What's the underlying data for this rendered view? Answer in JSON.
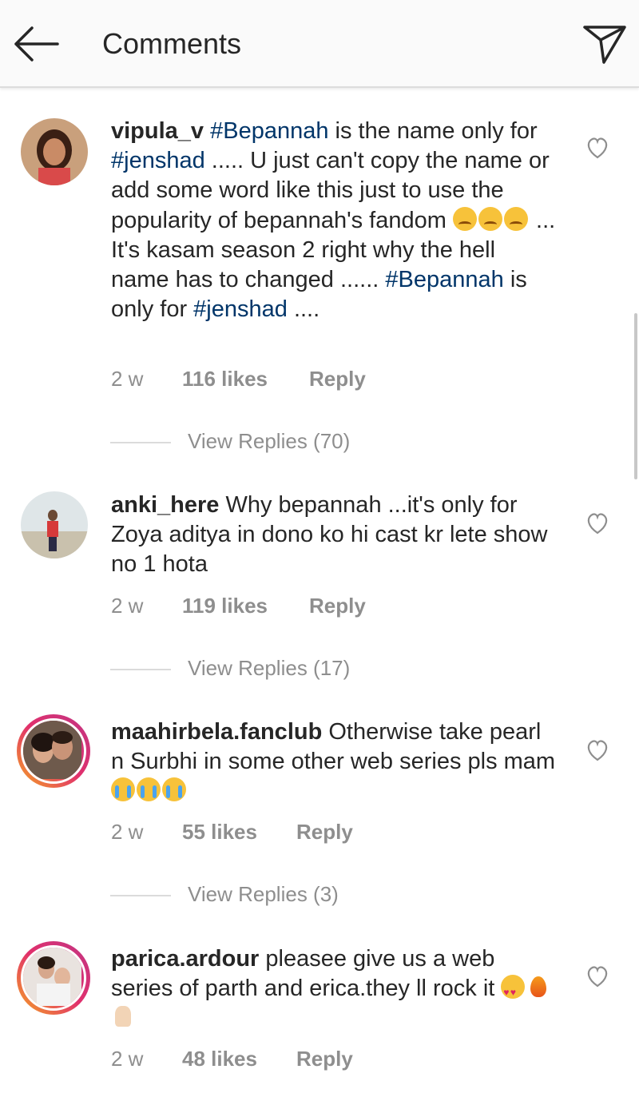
{
  "header": {
    "title": "Comments",
    "back_icon": "back-arrow-icon",
    "send_icon": "direct-send-icon"
  },
  "comments": [
    {
      "username": "vipula_v",
      "parts": [
        {
          "t": "tag",
          "v": "#Bepannah"
        },
        {
          "t": "text",
          "v": " is the name only for "
        },
        {
          "t": "tag",
          "v": "#jenshad"
        },
        {
          "t": "text",
          "v": " ..... U just can't copy the name or add some word like this just to use the popularity of bepannah's fandom "
        },
        {
          "t": "emoji",
          "v": "sad"
        },
        {
          "t": "emoji",
          "v": "sad"
        },
        {
          "t": "emoji",
          "v": "sad"
        },
        {
          "t": "text",
          "v": " ... It's kasam season 2 right why the hell name has to changed ...... "
        },
        {
          "t": "tag",
          "v": "#Bepannah"
        },
        {
          "t": "text",
          "v": " is only for "
        },
        {
          "t": "tag",
          "v": "#jenshad"
        },
        {
          "t": "text",
          "v": " ...."
        }
      ],
      "time": "2 w",
      "likes": "116 likes",
      "reply": "Reply",
      "view_replies": "View Replies (70)"
    },
    {
      "username": "anki_here",
      "parts": [
        {
          "t": "text",
          "v": " Why bepannah ...it's only for Zoya aditya in dono ko hi cast kr lete show no 1 hota"
        }
      ],
      "time": "2 w",
      "likes": "119 likes",
      "reply": "Reply",
      "view_replies": "View Replies (17)"
    },
    {
      "username": "maahirbela.fanclub",
      "parts": [
        {
          "t": "text",
          "v": " Otherwise take pearl n Surbhi in some other web series pls mam"
        },
        {
          "t": "emoji",
          "v": "cry"
        },
        {
          "t": "emoji",
          "v": "cry"
        },
        {
          "t": "emoji",
          "v": "cry"
        }
      ],
      "time": "2 w",
      "likes": "55 likes",
      "reply": "Reply",
      "view_replies": "View Replies (3)"
    },
    {
      "username": "parica.ardour",
      "parts": [
        {
          "t": "text",
          "v": " pleasee give us a web series of parth and erica.they ll rock it "
        },
        {
          "t": "emoji",
          "v": "love"
        },
        {
          "t": "emoji",
          "v": "fire"
        },
        {
          "t": "emoji",
          "v": "pray"
        }
      ],
      "time": "2 w",
      "likes": "48 likes",
      "reply": "Reply",
      "view_replies": ""
    }
  ],
  "colors": {
    "hashtag": "#003569",
    "secondary_text": "#8e8e8e",
    "story_ring": [
      "#f5a623",
      "#e1306c",
      "#c13584"
    ]
  }
}
